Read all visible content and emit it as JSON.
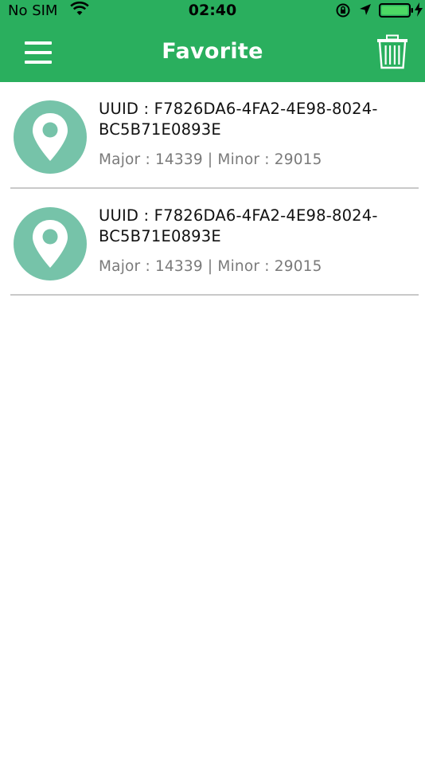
{
  "status_bar": {
    "carrier": "No SIM",
    "time": "02:40"
  },
  "header": {
    "title": "Favorite",
    "menu_icon": "hamburger-menu-icon",
    "trash_icon": "trash-icon",
    "background_color": "#2aaf5e"
  },
  "favorites": [
    {
      "uuid_line1": "UUID : F7826DA6-4FA2-4E98-8024-",
      "uuid_line2": "BC5B71E0893E",
      "meta": "Major : 14339 | Minor : 29015",
      "icon": "location-pin-icon"
    },
    {
      "uuid_line1": "UUID : F7826DA6-4FA2-4E98-8024-",
      "uuid_line2": "BC5B71E0893E",
      "meta": "Major : 14339 | Minor : 29015",
      "icon": "location-pin-icon"
    }
  ],
  "colors": {
    "accent_green": "#2aaf5e",
    "pin_circle": "#76c3a9"
  }
}
